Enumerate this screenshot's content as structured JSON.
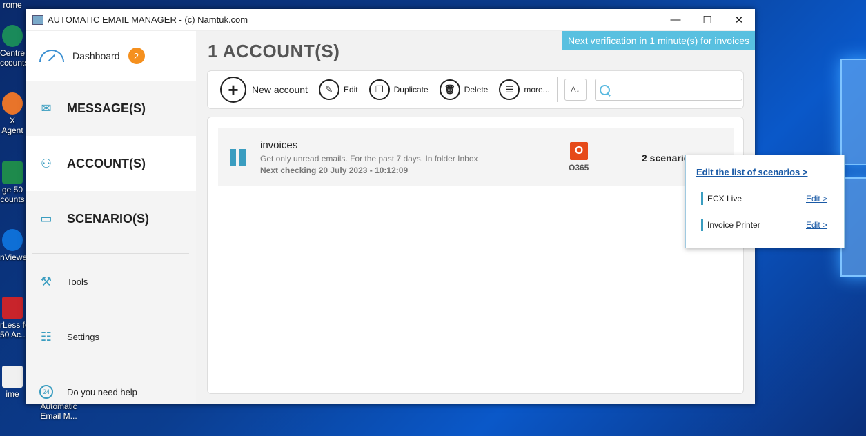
{
  "desktop": {
    "items": [
      "rome",
      "Centre\nccounts",
      "X Agent",
      "ge 50\ncounts",
      "nViewer",
      "rLess fo\n50 Ac...",
      "ime"
    ],
    "taskbar_label": "Automatic\nEmail M..."
  },
  "window": {
    "title": "AUTOMATIC EMAIL MANAGER - (c) Namtuk.com",
    "minimize": "—",
    "maximize": "☐",
    "close": "✕"
  },
  "sidebar": {
    "dashboard": {
      "label": "Dashboard",
      "badge": "2"
    },
    "messages": "MESSAGE(S)",
    "accounts": "ACCOUNT(S)",
    "scenarios": "SCENARIO(S)",
    "tools": "Tools",
    "settings": "Settings",
    "help": "Do you need help",
    "help_badge": "24"
  },
  "main": {
    "verification": "Next verification in 1 minute(s) for invoices",
    "title": "1 ACCOUNT(S)",
    "toolbar": {
      "new_account": "New account",
      "edit": "Edit",
      "duplicate": "Duplicate",
      "delete": "Delete",
      "more": "more..."
    },
    "search": {
      "placeholder": ""
    }
  },
  "account": {
    "name": "invoices",
    "description": "Get only unread emails. For the past 7 days. In folder Inbox",
    "next_check": "Next checking 20 July 2023 - 10:12:09",
    "provider": "O365",
    "scenarios": "2 scenarios"
  },
  "popup": {
    "title": "Edit the list of scenarios >",
    "items": [
      {
        "name": "ECX Live",
        "action": "Edit >"
      },
      {
        "name": "Invoice Printer",
        "action": "Edit >"
      }
    ]
  }
}
